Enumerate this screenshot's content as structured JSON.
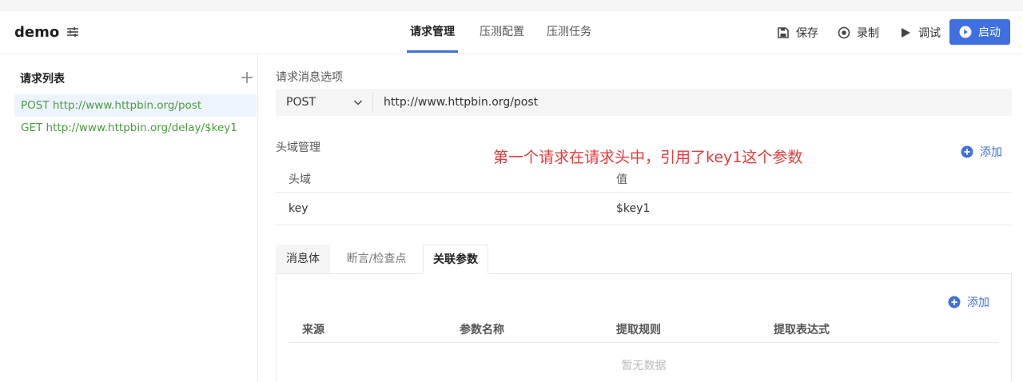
{
  "header": {
    "title": "demo",
    "tabs": [
      {
        "label": "请求管理",
        "active": true
      },
      {
        "label": "压测配置",
        "active": false
      },
      {
        "label": "压测任务",
        "active": false
      }
    ],
    "actions": {
      "save": "保存",
      "record": "录制",
      "debug": "调试",
      "start": "启动"
    }
  },
  "sidebar": {
    "title": "请求列表",
    "items": [
      {
        "label": "POST http://www.httpbin.org/post",
        "selected": true
      },
      {
        "label": "GET http://www.httpbin.org/delay/$key1",
        "selected": false
      }
    ]
  },
  "request": {
    "section_label": "请求消息选项",
    "method": "POST",
    "url": "http://www.httpbin.org/post"
  },
  "headers_section": {
    "label": "头域管理",
    "add_label": "添加",
    "columns": [
      "头域",
      "值"
    ],
    "rows": [
      {
        "name": "key",
        "value": "$key1"
      }
    ]
  },
  "annotation": "第一个请求在请求头中，引用了key1这个参数",
  "subtabs": {
    "tabs": [
      {
        "label": "消息体",
        "active": false
      },
      {
        "label": "断言/检查点",
        "active": false
      },
      {
        "label": "关联参数",
        "active": true
      }
    ],
    "add_label": "添加",
    "columns": [
      "来源",
      "参数名称",
      "提取规则",
      "提取表达式"
    ],
    "empty_text": "暂无数据"
  },
  "colors": {
    "accent": "#3f6fe0",
    "request_text": "#4b9a3f",
    "annotation": "#e8393a"
  }
}
